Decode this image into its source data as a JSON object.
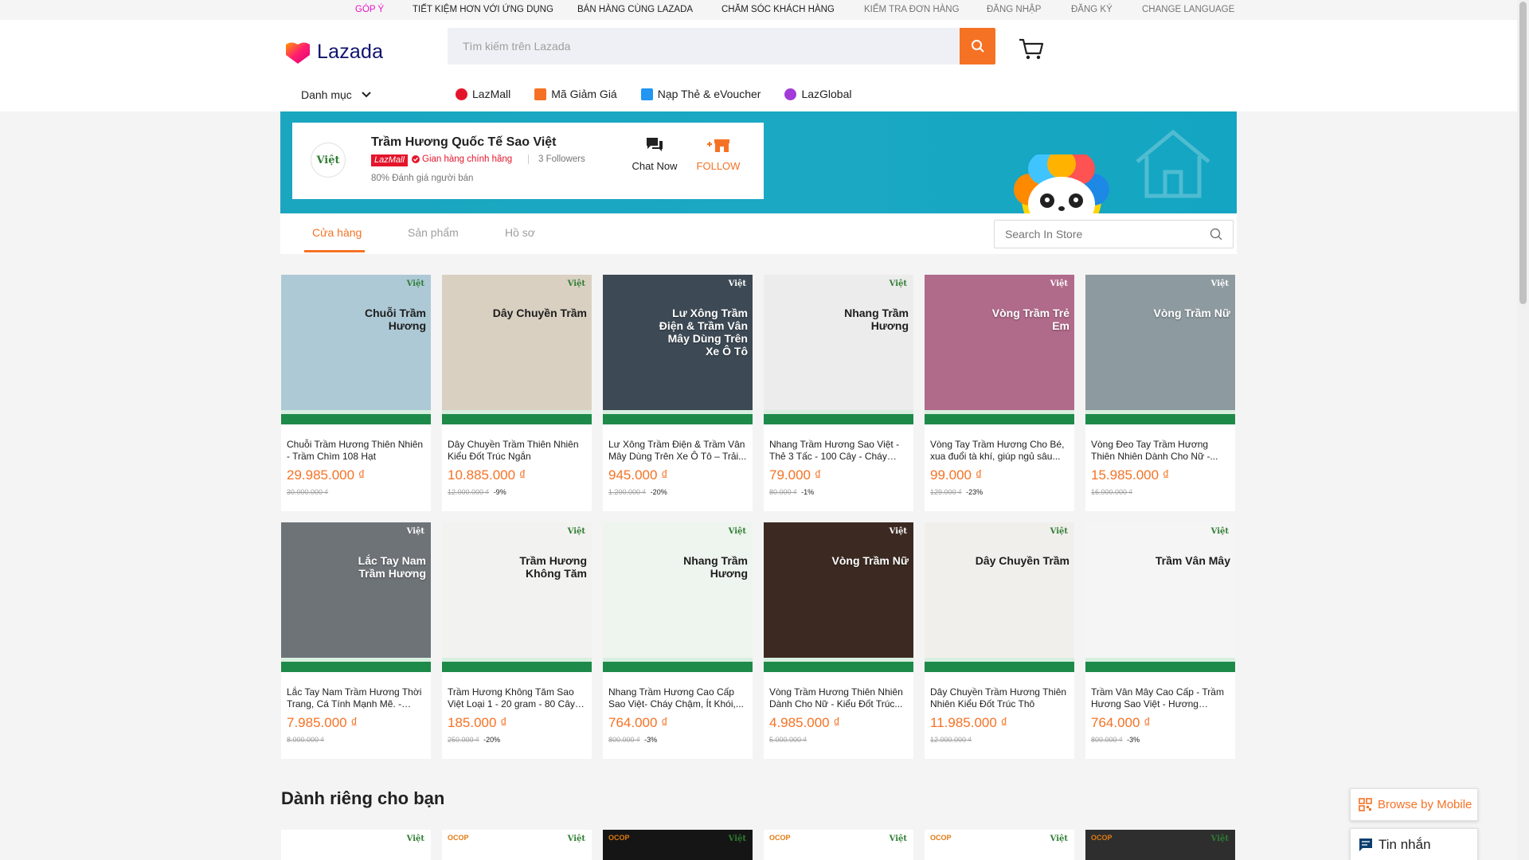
{
  "topbar": {
    "feedback": "GÓP Ý",
    "save_app": "TIẾT KIỆM HƠN VỚI ỨNG DỤNG",
    "sell": "BÁN HÀNG CÙNG LAZADA",
    "customer_care": "CHĂM SÓC KHÁCH HÀNG",
    "track_order": "KIỂM TRA ĐƠN HÀNG",
    "login": "ĐĂNG NHẬP",
    "signup": "ĐĂNG KÝ",
    "language": "CHANGE LANGUAGE"
  },
  "header": {
    "logo_text": "Lazada",
    "search_placeholder": "Tìm kiếm trên Lazada",
    "category_label": "Danh mục",
    "nav": [
      {
        "label": "LazMall",
        "icon": "lazmall-icon",
        "color": "#e4152b"
      },
      {
        "label": "Mã Giảm Giá",
        "icon": "voucher-icon",
        "color": "#f57224"
      },
      {
        "label": "Nạp Thẻ & eVoucher",
        "icon": "topup-icon",
        "color": "#2196f3"
      },
      {
        "label": "LazGlobal",
        "icon": "global-icon",
        "color": "#a23bd8"
      }
    ]
  },
  "store": {
    "name": "Trầm Hương Quốc Tế Sao Việt",
    "logo_text": "Việt",
    "badge": "LazMall",
    "official": "Gian hàng chính hãng",
    "followers": "3 Followers",
    "rating": "80% Đánh giá người bán",
    "chat_label": "Chat Now",
    "follow_label": "FOLLOW"
  },
  "tabs": {
    "store": "Cửa hàng",
    "products": "Sản phẩm",
    "profile": "Hồ sơ",
    "search_placeholder": "Search In Store"
  },
  "products": [
    {
      "name": "Chuỗi Trầm Hương Thiên Nhiên - Trầm Chìm 108 Hạt",
      "price": "29.985.000 ₫",
      "original": "30.000.000 ₫",
      "discount": "",
      "overlay": "Chuỗi Trầm Hương",
      "bg": "#aec9d6"
    },
    {
      "name": "Dây Chuyền Trầm Thiên Nhiên Kiểu Đốt Trúc Ngắn",
      "price": "10.885.000 ₫",
      "original": "12.000.000 ₫",
      "discount": "-9%",
      "overlay": "Dây Chuyền Trầm",
      "bg": "#d9d0c2"
    },
    {
      "name": "Lư Xông Trầm Điện & Trầm Vân Mây Dùng Trên Xe Ô Tô – Trải...",
      "price": "945.000 ₫",
      "original": "1.200.000 ₫",
      "discount": "-20%",
      "overlay": "Lư Xông Trầm Điện & Trầm Vân Mây Dùng Trên Xe Ô Tô",
      "bg": "#3d4a55"
    },
    {
      "name": "Nhang Trầm Hương Sao Việt - Thẻ 3 Tấc - 100 Cây - Cháy Lâu...",
      "price": "79.000 ₫",
      "original": "80.000 ₫",
      "discount": "-1%",
      "overlay": "Nhang Trầm Hương",
      "bg": "#ececec"
    },
    {
      "name": "Vòng Tay Trầm Hương Cho Bé, xua đuổi tà khí, giúp ngủ sâu...",
      "price": "99.000 ₫",
      "original": "129.000 ₫",
      "discount": "-23%",
      "overlay": "Vòng Trầm Trẻ Em",
      "bg": "#b06a8a"
    },
    {
      "name": "Vòng Đeo Tay Trầm Hương Thiên Nhiên Dành Cho Nữ -...",
      "price": "15.985.000 ₫",
      "original": "16.000.000 ₫",
      "discount": "",
      "overlay": "Vòng Trầm Nữ",
      "bg": "#8d9aa0"
    },
    {
      "name": "Lắc Tay Nam Trầm Hương Thời Trang, Cá Tính Mạnh Mẽ. - Trầ...",
      "price": "7.985.000 ₫",
      "original": "8.000.000 ₫",
      "discount": "",
      "overlay": "Lắc Tay Nam Trầm Hương",
      "bg": "#6e7378"
    },
    {
      "name": "Trầm Hương Không Tăm Sao Việt Loại 1 - 20 gram - 80 Cây -...",
      "price": "185.000 ₫",
      "original": "250.000 ₫",
      "discount": "-20%",
      "overlay": "Trầm Hương Không Tăm",
      "bg": "#f2f2f0"
    },
    {
      "name": "Nhang Trầm Hương Cao Cấp Sao Việt- Cháy Chậm, Ít Khói,...",
      "price": "764.000 ₫",
      "original": "800.000 ₫",
      "discount": "-3%",
      "overlay": "Nhang Trầm Hương",
      "bg": "#eef4ee"
    },
    {
      "name": "Vòng Trầm Hương Thiên Nhiên Dành Cho Nữ - Kiểu Đốt Trúc...",
      "price": "4.985.000 ₫",
      "original": "5.000.000 ₫",
      "discount": "",
      "overlay": "Vòng Trầm Nữ",
      "bg": "#3c2a22"
    },
    {
      "name": "Dây Chuyền Trầm Hương Thiên Nhiên Kiểu Đốt Trúc Thô",
      "price": "11.985.000 ₫",
      "original": "12.000.000 ₫",
      "discount": "",
      "overlay": "Dây Chuyền Trầm",
      "bg": "#f1efec"
    },
    {
      "name": "Trầm Vân Mây Cao Cấp - Trầm Hương Sao Việt - Hương Trầm...",
      "price": "764.000 ₫",
      "original": "800.000 ₫",
      "discount": "-3%",
      "overlay": "Trầm Vân Mây",
      "bg": "#f5f5f5"
    }
  ],
  "for_you": {
    "title": "Dành riêng cho bạn",
    "tiles": [
      {
        "bg": "#ffffff",
        "ocop": ""
      },
      {
        "bg": "#ffffff",
        "ocop": "OCOP"
      },
      {
        "bg": "#151515",
        "ocop": "OCOP"
      },
      {
        "bg": "#ffffff",
        "ocop": "OCOP"
      },
      {
        "bg": "#ffffff",
        "ocop": "OCOP"
      },
      {
        "bg": "#2e2e2e",
        "ocop": "OCOP"
      }
    ]
  },
  "floating": {
    "browse_mobile": "Browse by Mobile",
    "messages": "Tin nhắn"
  },
  "colors": {
    "accent": "#f57224",
    "brand": "#0f136d",
    "lazmall": "#e4152b",
    "banner": "#1aa6bf"
  }
}
